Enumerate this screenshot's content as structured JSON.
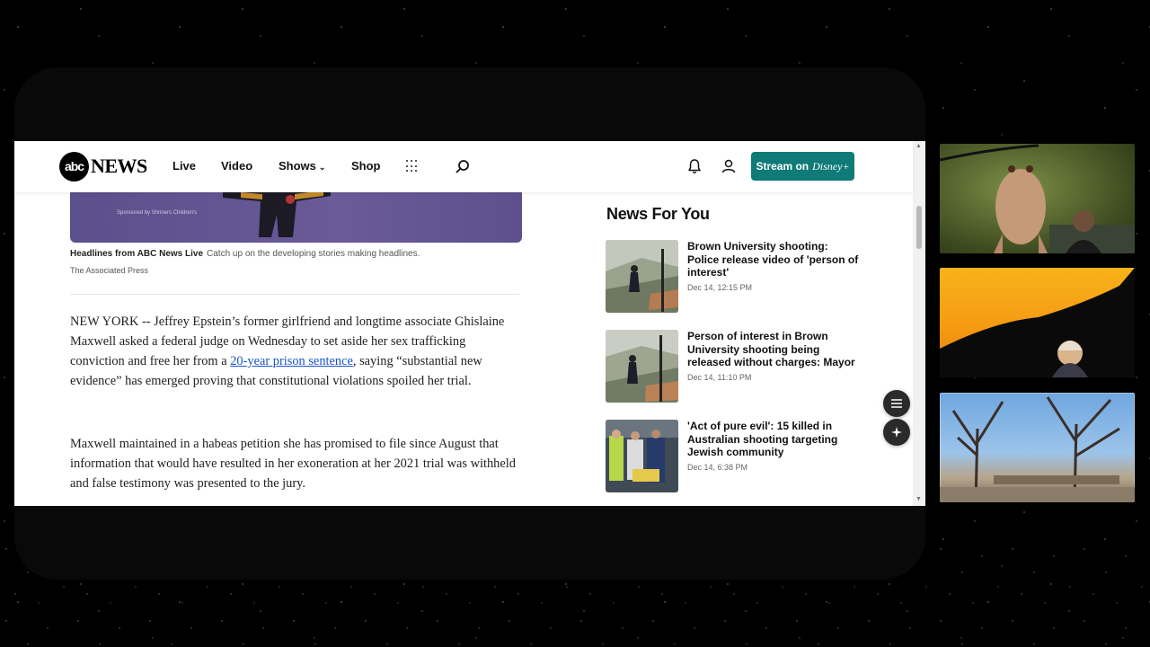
{
  "nav": {
    "logo_disc": "abc",
    "logo_text": "NEWS",
    "links": [
      "Live",
      "Video",
      "Shows",
      "Shop"
    ],
    "stream_label": "Stream on",
    "stream_brand": "Disney+"
  },
  "hero": {
    "sponsor_text": "Sponsored by Shriners Children's",
    "caption_title": "Headlines from ABC News Live",
    "caption_text": "Catch up on the developing stories making headlines.",
    "credit": "The Associated Press"
  },
  "article": {
    "p1_before_link": "NEW YORK -- Jeffrey Epstein’s former girlfriend and longtime associate Ghislaine Maxwell asked a federal judge on Wednesday to set aside her sex trafficking conviction and free her from a ",
    "p1_link": "20-year prison sentence",
    "p1_after_link": ", saying “substantial new evidence” has emerged proving that constitutional violations spoiled her trial.",
    "p2": "Maxwell maintained in a habeas petition she has promised to file since August that information that would have resulted in her exoneration at her 2021 trial was withheld and false testimony was presented to the jury."
  },
  "news_for_you": {
    "title": "News For You",
    "stories": [
      {
        "headline": "Brown University shooting: Police release video of 'person of interest'",
        "time": "Dec 14, 12:15 PM"
      },
      {
        "headline": "Person of interest in Brown University shooting being released without charges: Mayor",
        "time": "Dec 14, 11:10 PM"
      },
      {
        "headline": "'Act of pure evil': 15 killed in Australian shooting targeting Jewish community",
        "time": "Dec 14, 6:38 PM"
      }
    ]
  },
  "colors": {
    "stream_button": "#0f7a77",
    "link": "#1a55c6",
    "hero_purple": "#5b4f8c"
  }
}
